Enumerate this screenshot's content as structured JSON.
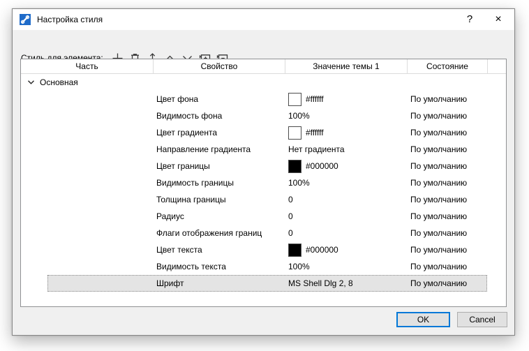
{
  "window": {
    "title": "Настройка стиля",
    "help_label": "?",
    "close_label": "×"
  },
  "toolbar": {
    "label": "Стиль для элемента:",
    "icons": [
      "plus-icon",
      "trash-icon",
      "move-vertical-icon",
      "chevron-up-icon",
      "chevron-down-icon",
      "folder-plus-icon",
      "folder-minus-icon"
    ]
  },
  "table": {
    "columns": [
      "Часть",
      "Свойство",
      "Значение темы 1",
      "Состояние"
    ],
    "group": {
      "label": "Основная",
      "expanded": true
    },
    "rows": [
      {
        "property": "Цвет фона",
        "swatch": "#ffffff",
        "value": "#ffffff",
        "state": "По умолчанию"
      },
      {
        "property": "Видимость фона",
        "value": "100%",
        "state": "По умолчанию"
      },
      {
        "property": "Цвет градиента",
        "swatch": "#ffffff",
        "value": "#ffffff",
        "state": "По умолчанию"
      },
      {
        "property": "Направление градиента",
        "value": "Нет градиента",
        "state": "По умолчанию"
      },
      {
        "property": "Цвет границы",
        "swatch": "#000000",
        "value": "#000000",
        "state": "По умолчанию"
      },
      {
        "property": "Видимость границы",
        "value": "100%",
        "state": "По умолчанию"
      },
      {
        "property": "Толщина границы",
        "value": "0",
        "state": "По умолчанию"
      },
      {
        "property": "Радиус",
        "value": "0",
        "state": "По умолчанию"
      },
      {
        "property": "Флаги отображения границ",
        "value": "0",
        "state": "По умолчанию"
      },
      {
        "property": "Цвет текста",
        "swatch": "#000000",
        "value": "#000000",
        "state": "По умолчанию"
      },
      {
        "property": "Видимость текста",
        "value": "100%",
        "state": "По умолчанию"
      },
      {
        "property": "Шрифт",
        "value": "MS Shell Dlg 2, 8",
        "state": "По умолчанию",
        "selected": true
      }
    ]
  },
  "footer": {
    "ok_label": "OK",
    "cancel_label": "Cancel"
  },
  "colors": {
    "accent": "#0078d7",
    "selection_bg": "#e4e4e4",
    "dialog_bg": "#f0f0f0",
    "titlebar_bg": "#ffffff",
    "icon_blue": "#1f6bc9"
  }
}
